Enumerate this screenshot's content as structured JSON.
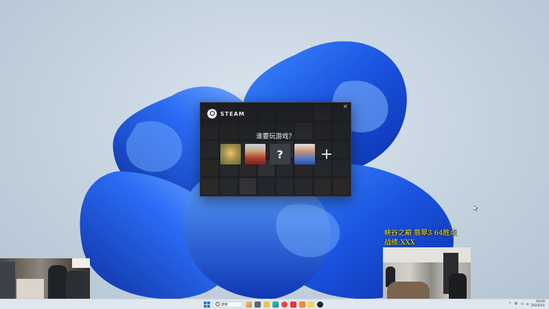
{
  "steam": {
    "brand": "STEAM",
    "question": "谁要玩游戏？",
    "close_glyph": "×",
    "unknown_avatar_glyph": "?",
    "add_glyph": "+"
  },
  "overlay": {
    "line1": "峡谷之巅 翡翠3 64胜点",
    "line2": "战绩:XXX"
  },
  "taskbar": {
    "search_placeholder": "搜索",
    "tray_lang": "中",
    "clock_time": "18:00",
    "clock_date": "2024/1/1",
    "icons": [
      "file-explorer-icon",
      "edge-icon",
      "store-icon",
      "music-icon",
      "app-red-icon",
      "app-orange-icon",
      "app-yellow-icon",
      "steam-icon"
    ]
  },
  "colors": {
    "overlay_text": "#f0e44a",
    "wallpaper_blue": "#1f5ee8",
    "start_blue": "#1c73d6"
  }
}
